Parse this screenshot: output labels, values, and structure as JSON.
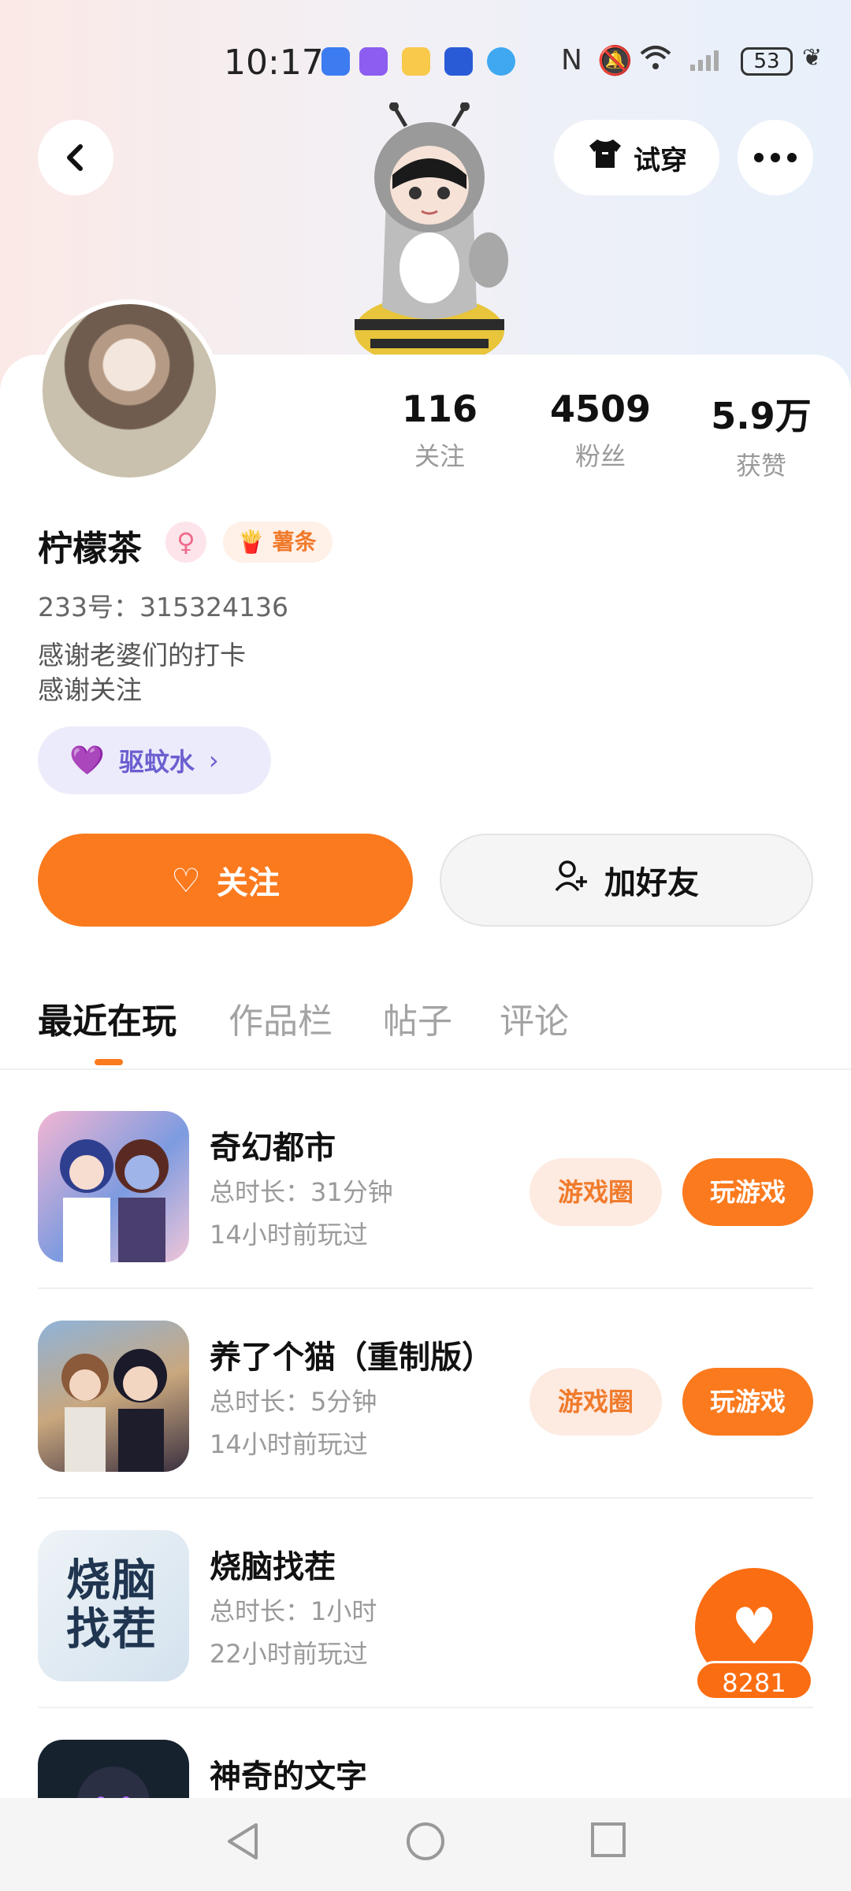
{
  "status_bar": {
    "time": "10:17",
    "battery": "53"
  },
  "header": {
    "back_icon": "chevron-left-icon",
    "try_on_label": "试穿",
    "more_icon": "more-icon"
  },
  "profile": {
    "stats": [
      {
        "value": "116",
        "label": "关注"
      },
      {
        "value": "4509",
        "label": "粉丝"
      },
      {
        "value": "5.9万",
        "label": "获赞"
      }
    ],
    "name": "柠檬茶",
    "tag": "薯条",
    "uid": "233号：315324136",
    "bio_lines": [
      "感谢老婆们的打卡",
      "感谢关注"
    ],
    "badge_label": "驱蚊水"
  },
  "actions": {
    "follow_label": "关注",
    "add_friend_label": "加好友"
  },
  "tabs": [
    "最近在玩",
    "作品栏",
    "帖子",
    "评论"
  ],
  "games": [
    {
      "title": "奇幻都市",
      "duration": "总时长：31分钟",
      "last_played": "14小时前玩过",
      "circle_label": "游戏圈",
      "play_label": "玩游戏"
    },
    {
      "title": "养了个猫（重制版）",
      "duration": "总时长：5分钟",
      "last_played": "14小时前玩过",
      "circle_label": "游戏圈",
      "play_label": "玩游戏"
    },
    {
      "title": "烧脑找茬",
      "duration": "总时长：1小时",
      "last_played": "22小时前玩过",
      "thumb_text": "烧脑找茬"
    },
    {
      "title": "神奇的文字"
    }
  ],
  "floating_like": {
    "count": "8281"
  },
  "colors": {
    "accent": "#fb7a1e",
    "accent_soft": "#fdeae0",
    "badge_bg": "#ecebfb"
  }
}
